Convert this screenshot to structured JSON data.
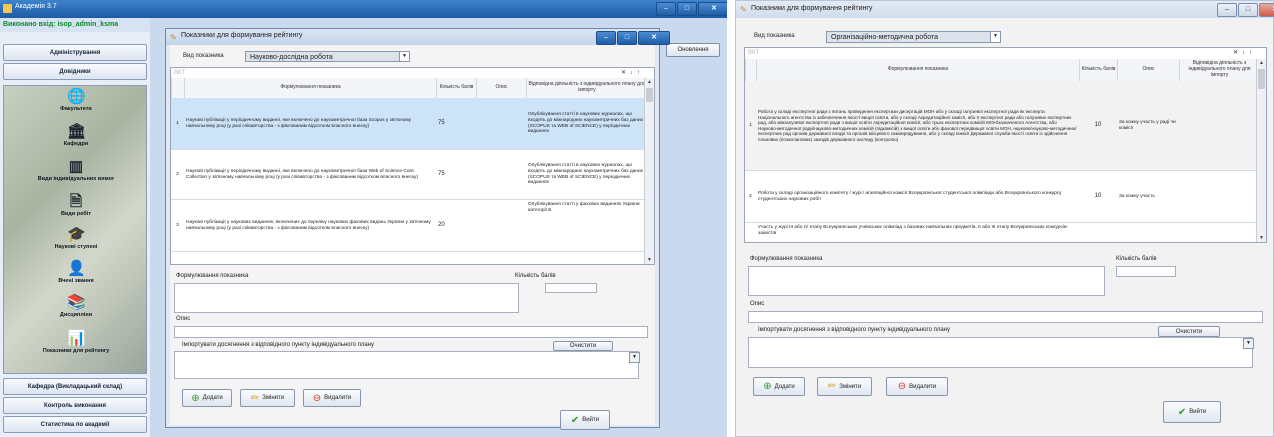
{
  "app": {
    "title": "Академія 3.7",
    "user": "Виконано вхід: isop_admin_ksma",
    "menu_top": [
      "Адміністрування",
      "Довідники"
    ],
    "nav": [
      {
        "label": "Факультети",
        "icon": "globe-icon",
        "glyph": "🌐"
      },
      {
        "label": "Кафедри",
        "icon": "building-icon",
        "glyph": "🏛"
      },
      {
        "label": "Види індивідуальних вимог",
        "icon": "columns-icon",
        "glyph": "▥"
      },
      {
        "label": "Види робіт",
        "icon": "document-icon",
        "glyph": "🗎"
      },
      {
        "label": "Наукові ступені",
        "icon": "graduate-icon",
        "glyph": "🎓"
      },
      {
        "label": "Вчені звання",
        "icon": "person-icon",
        "glyph": "👤"
      },
      {
        "label": "Дисципліни",
        "icon": "books-icon",
        "glyph": "📚"
      },
      {
        "label": "Показники для рейтингу",
        "icon": "chart-icon",
        "glyph": "📊"
      }
    ],
    "menu_bottom": [
      "Кафедра (Викладацький склад)",
      "Контроль виконання",
      "Статистика по академії"
    ],
    "refresh": "Оновлення"
  },
  "dialog1": {
    "title": "Показники для формування рейтингу",
    "kind_label": "Вид показника",
    "kind_value": "Науково-дослідна робота",
    "filter_placeholder": "ВКТ",
    "columns": [
      "Формулювання показника",
      "Кількість балів",
      "Опис",
      "Відповідна діяльність з індивідуального плану для імпорту"
    ],
    "rows": [
      {
        "n": "1",
        "text": "Наукові публікації у періодичному виданні, яке включено до наукометричної бази Scopus у зв'язному навчальному році (у разі співавторства - з фіксованим відсотком власного внеску)",
        "points": "75",
        "desc": "",
        "activity": "Опублікування статті в наукових журналах, що входять до міжнародних наукометричних баз даних (SCOPUS та WEB of SCIENCE) у періодичних виданнях"
      },
      {
        "n": "2",
        "text": "Наукові публікації у періодичному виданні, яке включено до наукометричної бази Web of Science Core Collection у зв'язному навчальному році (у разі співавторства - з фіксованим відсотком власного внеску)",
        "points": "75",
        "desc": "",
        "activity": "Опублікування статті в наукових журналах, що входять до міжнародних наукометричних баз даних (SCOPUS та WEB of SCIENCE) у періодичних виданнях"
      },
      {
        "n": "3",
        "text": "Наукові публікації у наукових виданнях, включених до переліку наукових фахових видань України у зв'язному навчальному році (у разі співавторства - з фіксованим відсотком власного внеску)",
        "points": "20",
        "desc": "",
        "activity": "Опублікування статті у фахових виданнях України категорії Б"
      }
    ],
    "form_label": "Формулювання показника",
    "points_label": "Кількість балів",
    "desc_label": "Опис",
    "import_label": "Імпортувати досягнення з відповідного пункту індивідуального плану",
    "clear": "Очистити",
    "add": "Додати",
    "edit": "Змінити",
    "delete": "Видалити",
    "exit": "Вийти"
  },
  "dialog2": {
    "title": "Показники для формування рейтингу",
    "kind_label": "Вид показника",
    "kind_value": "Організаційно-методична робота",
    "filter_placeholder": "ВКТ",
    "columns": [
      "Формулювання показника",
      "Кількість балів",
      "Опис",
      "Відповідна діяльність з індивідуального плану для імпорту"
    ],
    "rows": [
      {
        "n": "1",
        "text": "Робота у складі експертної ради з питань проведення експертизи дисертацій МОН або у складі галузевої експертної ради як експерта Національного агентства із забезпечення якості вищої освіти, або у складі Акредитаційної комісії, або її експертної ради або галузевих експертних рад, або міжгалузевої експертної ради з вищої освіти Акредитаційної комісії, або трьох експертних комісій МОН/зазначеного Агентства, або Науково-методичної ради/науково-методичних комісій (підкомісій) з вищої освіти або фахової передвищої освіти МОН, науково/науково-методичних/експертних рад органів державної влади та органів місцевого самоврядування, або у складі комісії Державної служби якості освіти із здійснення планових (позапланових) заходів державного нагляду (контролю)",
        "points": "10",
        "desc": "За кожну участь у раді чи комісії",
        "activity": ""
      },
      {
        "n": "2",
        "text": "Робота у складі організаційного комітету / журі / апеляційної комісії Всеукраїнської студентської олімпіади або Всеукраїнського конкурсу студентських наукових робіт",
        "points": "10",
        "desc": "За кожну участь",
        "activity": ""
      },
      {
        "n": "",
        "text": "Участь у журі III або IV етапу Всеукраїнських учнівських олімпіад з базових навчальних предметів, II або III етапу Всеукраїнських конкурсів-захистів",
        "points": "",
        "desc": "",
        "activity": ""
      }
    ],
    "form_label": "Формулювання показника",
    "points_label": "Кількість балів",
    "desc_label": "Опис",
    "import_label": "Імпортувати досягнення з відповідного пункту індивідуального плану",
    "clear": "Очистити",
    "add": "Додати",
    "edit": "Змінити",
    "delete": "Видалити",
    "exit": "Вийти"
  },
  "colors": {
    "accent": "#1e5ea8",
    "user_text": "#0a8a2a",
    "selected_row": "#cde3f8"
  }
}
